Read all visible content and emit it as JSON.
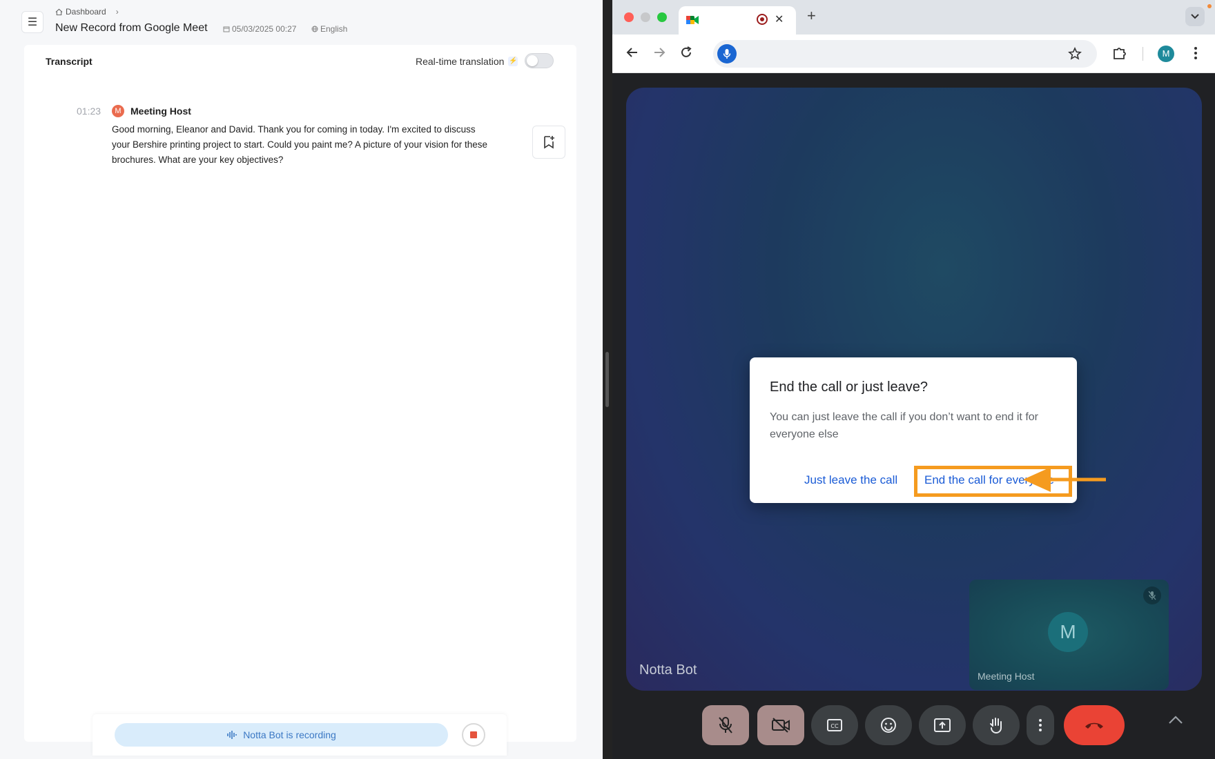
{
  "notta": {
    "breadcrumb": {
      "home_label": "Dashboard"
    },
    "title": "New Record from Google Meet",
    "date": "05/03/2025 00:27",
    "language": "English",
    "transcript": {
      "heading": "Transcript",
      "realtime_label": "Real-time translation",
      "realtime_enabled": false,
      "entries": [
        {
          "time": "01:23",
          "speaker_initial": "M",
          "speaker": "Meeting Host",
          "text": "Good morning, Eleanor and David. Thank you for coming in today. I'm excited to discuss your Bershire printing project to start. Could you paint me? A picture of your vision for these brochures. What are your key objectives?"
        }
      ]
    },
    "recording": {
      "status_text": "Notta Bot is recording"
    },
    "colors": {
      "accent": "#3b78c4",
      "speaker_avatar": "#ea6b4e",
      "stop": "#e5533d"
    }
  },
  "browser": {
    "profile_initial": "M",
    "tab": {
      "icon": "google-meet-icon",
      "recording": true
    }
  },
  "meet": {
    "stage_participant": "Notta Bot",
    "self_tile": {
      "initial": "M",
      "name": "Meeting Host",
      "mic_muted": true
    },
    "dialog": {
      "title": "End the call or just leave?",
      "body": "You can just leave the call if you don’t want to end it for everyone else",
      "leave_label": "Just leave the call",
      "end_all_label": "End the call for everyone"
    },
    "controls": [
      "mic-off-icon",
      "camera-off-icon",
      "captions-icon",
      "emoji-icon",
      "present-icon",
      "raise-hand-icon",
      "more-options-icon",
      "end-call-icon",
      "chevron-up-icon"
    ],
    "colors": {
      "highlight": "#f59b1f",
      "link": "#1a5bd6",
      "end_call": "#ea4335"
    }
  }
}
